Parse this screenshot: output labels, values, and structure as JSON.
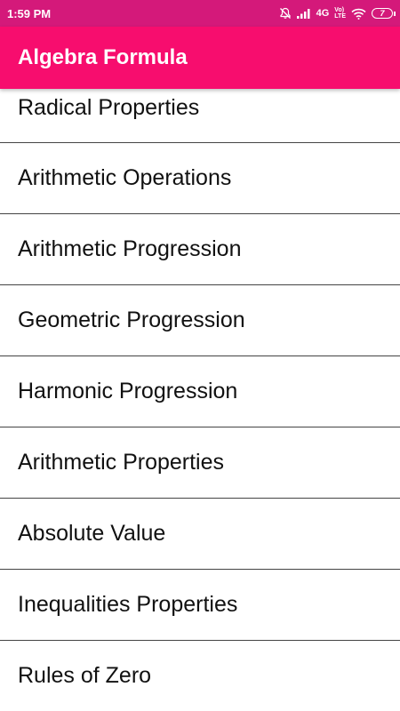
{
  "status_bar": {
    "time": "1:59 PM",
    "network": "4G",
    "volte_top": "Vo)",
    "volte_bottom": "LTE",
    "battery": "7",
    "icons": [
      "mute-bell-icon",
      "signal-icon",
      "wifi-icon",
      "battery-icon"
    ]
  },
  "app_bar": {
    "title": "Algebra Formula"
  },
  "colors": {
    "status_bar": "#d4197a",
    "app_bar": "#f70d6e",
    "divider": "#444444"
  },
  "list": {
    "items": [
      {
        "label": "Radical Properties"
      },
      {
        "label": "Arithmetic Operations"
      },
      {
        "label": "Arithmetic Progression"
      },
      {
        "label": "Geometric Progression"
      },
      {
        "label": "Harmonic Progression"
      },
      {
        "label": "Arithmetic Properties"
      },
      {
        "label": "Absolute Value"
      },
      {
        "label": "Inequalities Properties"
      },
      {
        "label": "Rules of Zero"
      }
    ]
  }
}
